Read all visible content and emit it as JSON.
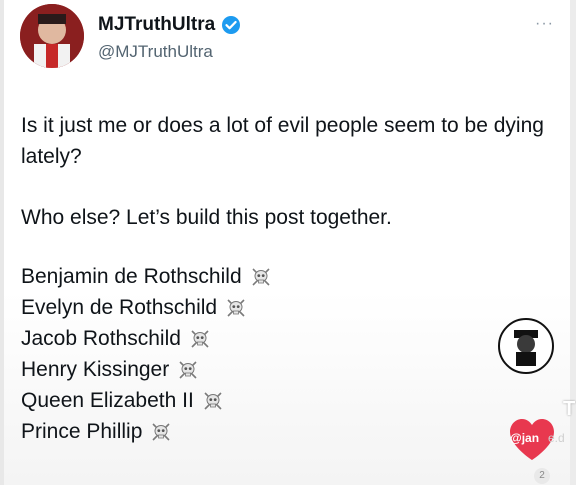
{
  "post": {
    "display_name": "MJTruthUltra",
    "handle": "@MJTruthUltra",
    "verified": true,
    "verified_badge_icon": "verified-badge-icon",
    "more_icon": "more-options-icon",
    "paragraph_1": "Is it just me or does a lot of evil people seem to be dying lately?",
    "paragraph_2": "Who else? Let’s build this post together.",
    "list_marker_icon": "skull-crossbones-icon",
    "names": [
      "Benjamin de Rothschild",
      "Evelyn de Rothschild",
      "Jacob Rothschild",
      "Henry Kissinger",
      "Queen Elizabeth II",
      "Prince Phillip"
    ]
  },
  "overlay": {
    "watermark_handle": "@jan",
    "watermark_handle_tail": "e.d",
    "edge_letter": "T",
    "small_badge": "2",
    "accent_color": "#e8384f"
  },
  "colors": {
    "text_primary": "#0f1419",
    "text_secondary": "#536471",
    "verified_blue": "#1d9bf0"
  }
}
